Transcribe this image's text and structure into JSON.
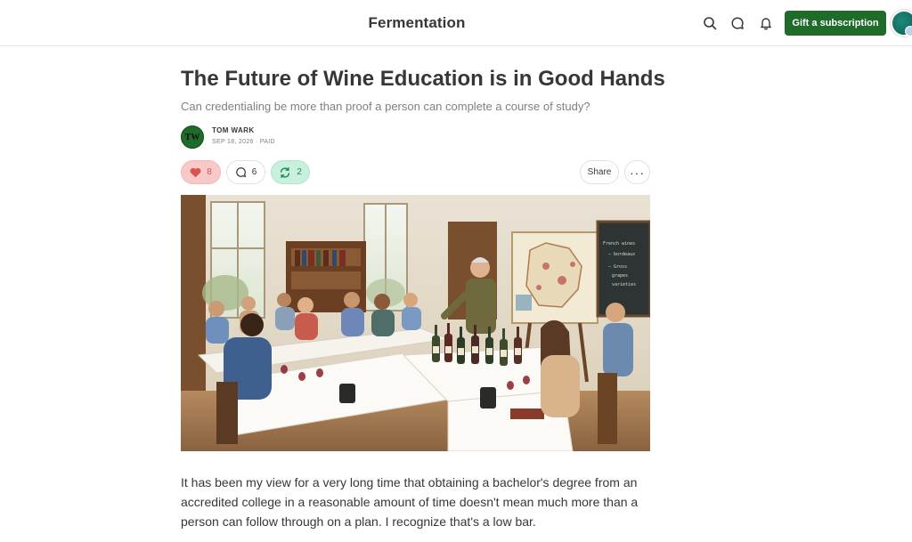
{
  "header": {
    "publication": "Fermentation",
    "gift_label": "Gift a subscription",
    "icons": [
      "search-icon",
      "chat-icon",
      "bell-icon"
    ]
  },
  "post": {
    "title": "The Future of Wine Education is in Good Hands",
    "subtitle": "Can credentialing be more than proof a person can complete a course of study?",
    "author": {
      "initials": "TW",
      "name": "TOM WARK"
    },
    "meta": "SEP 18, 2026 · PAID",
    "actions": {
      "likes": "8",
      "comments": "6",
      "restacks": "2",
      "share_label": "Share",
      "more_label": "···"
    },
    "hero_chalkboard": [
      "French wines",
      "— bordeaux",
      "— Gross",
      "grapes",
      "varieties"
    ],
    "body": "It has been my view for a very long time that obtaining a bachelor's degree from an accredited college in a reasonable amount of time doesn't mean much more than a person can follow through on a plan. I recognize that's a low bar."
  },
  "colors": {
    "brand_green": "#1e6b2a",
    "like_bg": "#f7c9c9",
    "restack_bg": "#c9f0dd"
  }
}
